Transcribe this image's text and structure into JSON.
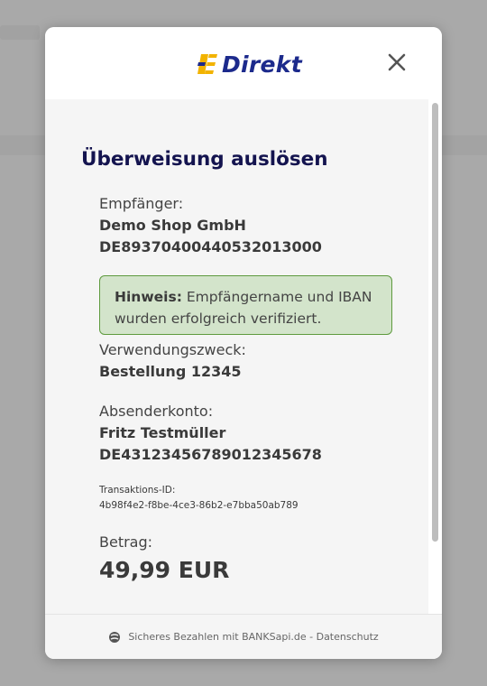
{
  "header": {
    "logo_text": "Direkt",
    "close_label": "×"
  },
  "transfer": {
    "title": "Überweisung auslösen",
    "recipient_label": "Empfänger:",
    "recipient_name": "Demo Shop GmbH",
    "recipient_iban": "DE89370400440532013000",
    "notice_bold": "Hinweis:",
    "notice_line1": " Empfängername und IBAN",
    "notice_line2": "wurden erfolgreich verifiziert.",
    "purpose_label": "Verwendungszweck:",
    "purpose_value": "Bestellung 12345",
    "sender_label": "Absenderkonto:",
    "sender_name": "Fritz Testmüller",
    "sender_iban": "DE43123456789012345678",
    "transaction_label": "Transaktions-ID:",
    "transaction_id": "4b98f4e2-f8be-4ce3-86b2-e7bba50ab789",
    "amount_label": "Betrag:",
    "amount_value": "49,99 EUR"
  },
  "footer": {
    "text": "Sicheres Bezahlen mit BANKSapi.de",
    "separator": " - ",
    "privacy_link": "Datenschutz"
  },
  "colors": {
    "brand_blue": "#1c2a8c",
    "brand_yellow": "#f2b300",
    "notice_bg": "#d3e4cb",
    "notice_border": "#5e9a3e",
    "title": "#14144f"
  },
  "icons": {
    "close": "close-icon",
    "logo": "direkt-logo-icon",
    "footer": "banksapi-icon"
  }
}
